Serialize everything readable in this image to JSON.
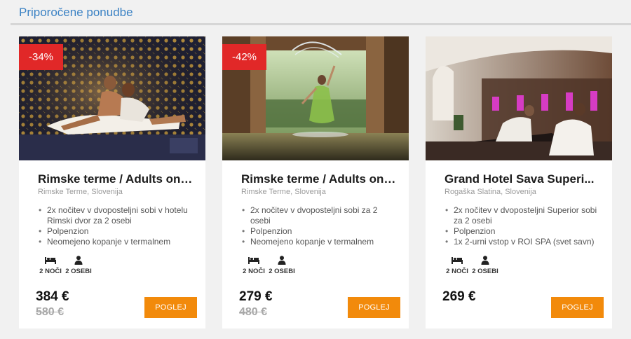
{
  "section": {
    "title": "Priporočene ponudbe"
  },
  "colors": {
    "accent_title": "#3b82c4",
    "discount_badge": "#e12828",
    "button": "#f28a0b"
  },
  "offers": [
    {
      "discount": "-34%",
      "name": "Rimske terme / Adults onl...",
      "location": "Rimske Terme, Slovenija",
      "features": [
        "2x nočitev v dvoposteljni sobi v hotelu Rimski dvor za 2 osebi",
        "Polpenzion",
        "Neomejeno kopanje v termalnem"
      ],
      "nights_label": "2 NOČI",
      "persons_label": "2 OSEBI",
      "price": "384 €",
      "old_price": "580 €",
      "button_label": "POGLEJ",
      "image_icon": "spa-sauna-photo"
    },
    {
      "discount": "-42%",
      "name": "Rimske terme / Adults onl...",
      "location": "Rimske Terme, Slovenija",
      "features": [
        "2x nočitev v dvoposteljni sobi za 2 osebi",
        "Polpenzion",
        "Neomejeno kopanje v termalnem"
      ],
      "nights_label": "2 NOČI",
      "persons_label": "2 OSEBI",
      "price": "279 €",
      "old_price": "480 €",
      "button_label": "POGLEJ",
      "image_icon": "pool-fountain-photo"
    },
    {
      "discount": "",
      "name": "Grand Hotel Sava Superi...",
      "location": "Rogaška Slatina, Slovenija",
      "features": [
        "2x nočitev v dvoposteljni Superior sobi za 2 osebi",
        "Polpenzion",
        "1x 2-urni vstop v ROI SPA (svet savn)"
      ],
      "nights_label": "2 NOČI",
      "persons_label": "2 OSEBI",
      "price": "269 €",
      "old_price": "",
      "button_label": "POGLEJ",
      "image_icon": "relax-lounge-photo"
    }
  ]
}
